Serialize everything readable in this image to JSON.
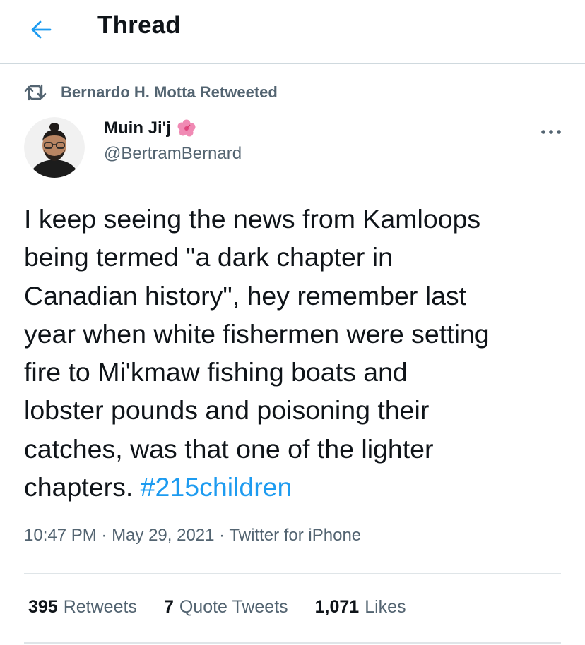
{
  "header": {
    "title": "Thread"
  },
  "retweet": {
    "text": "Bernardo H. Motta Retweeted"
  },
  "author": {
    "display_name": "Muin Ji'j",
    "handle": "@BertramBernard"
  },
  "tweet": {
    "text": "I keep seeing the news from Kamloops\nbeing termed \"a dark chapter in\nCanadian history\", hey remember last\nyear when white fishermen were setting\nfire to Mi'kmaw fishing boats and\nlobster pounds and poisoning their\ncatches, was that one of the lighter\nchapters. ",
    "hashtag": "#215children"
  },
  "meta": {
    "time": "10:47 PM",
    "separator": " · ",
    "date": "May 29, 2021",
    "source": "Twitter for iPhone"
  },
  "stats": {
    "retweets_count": "395",
    "retweets_label": "Retweets",
    "quotes_count": "7",
    "quotes_label": "Quote Tweets",
    "likes_count": "1,071",
    "likes_label": "Likes"
  },
  "colors": {
    "accent": "#1d9bf0",
    "secondary_text": "#536471",
    "primary_text": "#0f1419",
    "divider": "#cfd9de"
  },
  "icons": {
    "back": "back-arrow-icon",
    "retweet": "retweet-icon",
    "more": "more-options-icon",
    "emoji": "hibiscus-flower-icon"
  }
}
